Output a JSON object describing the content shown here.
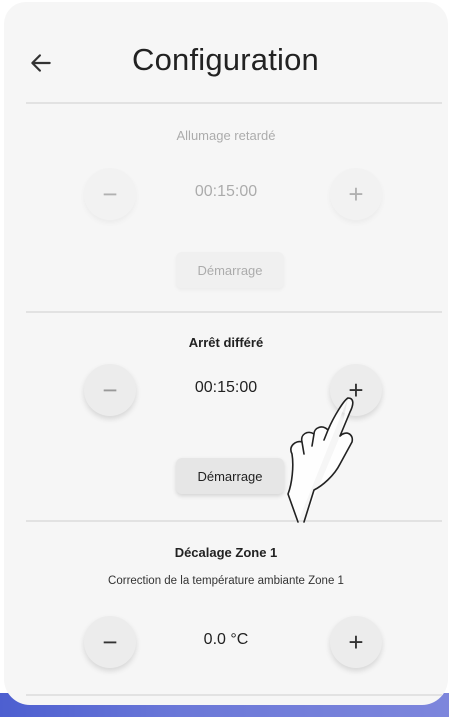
{
  "header": {
    "title": "Configuration"
  },
  "sections": [
    {
      "title": "Allumage retardé",
      "value": "00:15:00",
      "minus": "−",
      "plus": "+",
      "action": "Démarrage",
      "state": "disabled"
    },
    {
      "title": "Arrêt différé",
      "value": "00:15:00",
      "minus": "−",
      "plus": "+",
      "action": "Démarrage",
      "state": "enabled"
    },
    {
      "title": "Décalage Zone 1",
      "subtitle": "Correction de la température ambiante Zone 1",
      "value": "0.0 °C",
      "minus": "−",
      "plus": "+",
      "state": "enabled"
    }
  ],
  "icons": {
    "back": "back-arrow-icon",
    "hand": "tap-hand-icon"
  },
  "colors": {
    "background": "#f6f6f6",
    "button": "#ececec",
    "accent": "#5a67d4"
  }
}
